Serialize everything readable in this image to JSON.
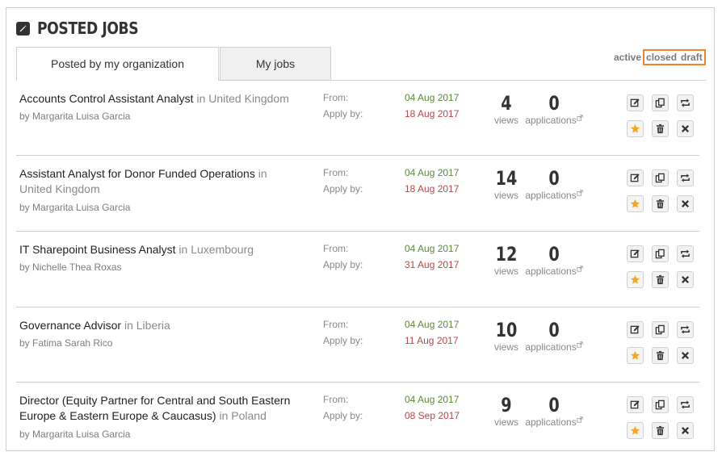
{
  "page_title": "POSTED JOBS",
  "tabs": [
    {
      "label": "Posted by my organization"
    },
    {
      "label": "My jobs"
    }
  ],
  "filters": {
    "active": "active",
    "closed": "closed",
    "draft": "draft"
  },
  "labels": {
    "from": "From:",
    "apply_by": "Apply by:",
    "views": "views",
    "applications": "applications"
  },
  "jobs": [
    {
      "title": "Accounts Control Assistant Analyst",
      "in": "in",
      "location": "United Kingdom",
      "by": "by",
      "author": "Margarita Luisa Garcia",
      "from": "04 Aug 2017",
      "apply_by": "18 Aug 2017",
      "views": "4",
      "applications": "0"
    },
    {
      "title": "Assistant Analyst for Donor Funded Operations",
      "in": "in",
      "location": "United Kingdom",
      "by": "by",
      "author": "Margarita Luisa Garcia",
      "from": "04 Aug 2017",
      "apply_by": "18 Aug 2017",
      "views": "14",
      "applications": "0"
    },
    {
      "title": "IT Sharepoint Business Analyst",
      "in": "in",
      "location": "Luxembourg",
      "by": "by",
      "author": "Nichelle Thea Roxas",
      "from": "04 Aug 2017",
      "apply_by": "31 Aug 2017",
      "views": "12",
      "applications": "0"
    },
    {
      "title": "Governance Advisor",
      "in": "in",
      "location": "Liberia",
      "by": "by",
      "author": "Fatima Sarah Rico",
      "from": "04 Aug 2017",
      "apply_by": "11 Aug 2017",
      "views": "10",
      "applications": "0"
    },
    {
      "title": "Director (Equity Partner for Central and South Eastern Europe & Eastern Europe & Caucasus)",
      "in": "in",
      "location": "Poland",
      "by": "by",
      "author": "Margarita Luisa Garcia",
      "from": "04 Aug 2017",
      "apply_by": "08 Sep 2017",
      "views": "9",
      "applications": "0"
    }
  ],
  "colors": {
    "from_date": "#5a8a3a",
    "apply_date": "#b24a4a",
    "highlight": "#f0842c",
    "star": "#f5a623"
  },
  "icons": [
    "edit-icon",
    "copy-icon",
    "repost-icon",
    "star-icon",
    "trash-icon",
    "close-icon",
    "external-link-icon"
  ]
}
